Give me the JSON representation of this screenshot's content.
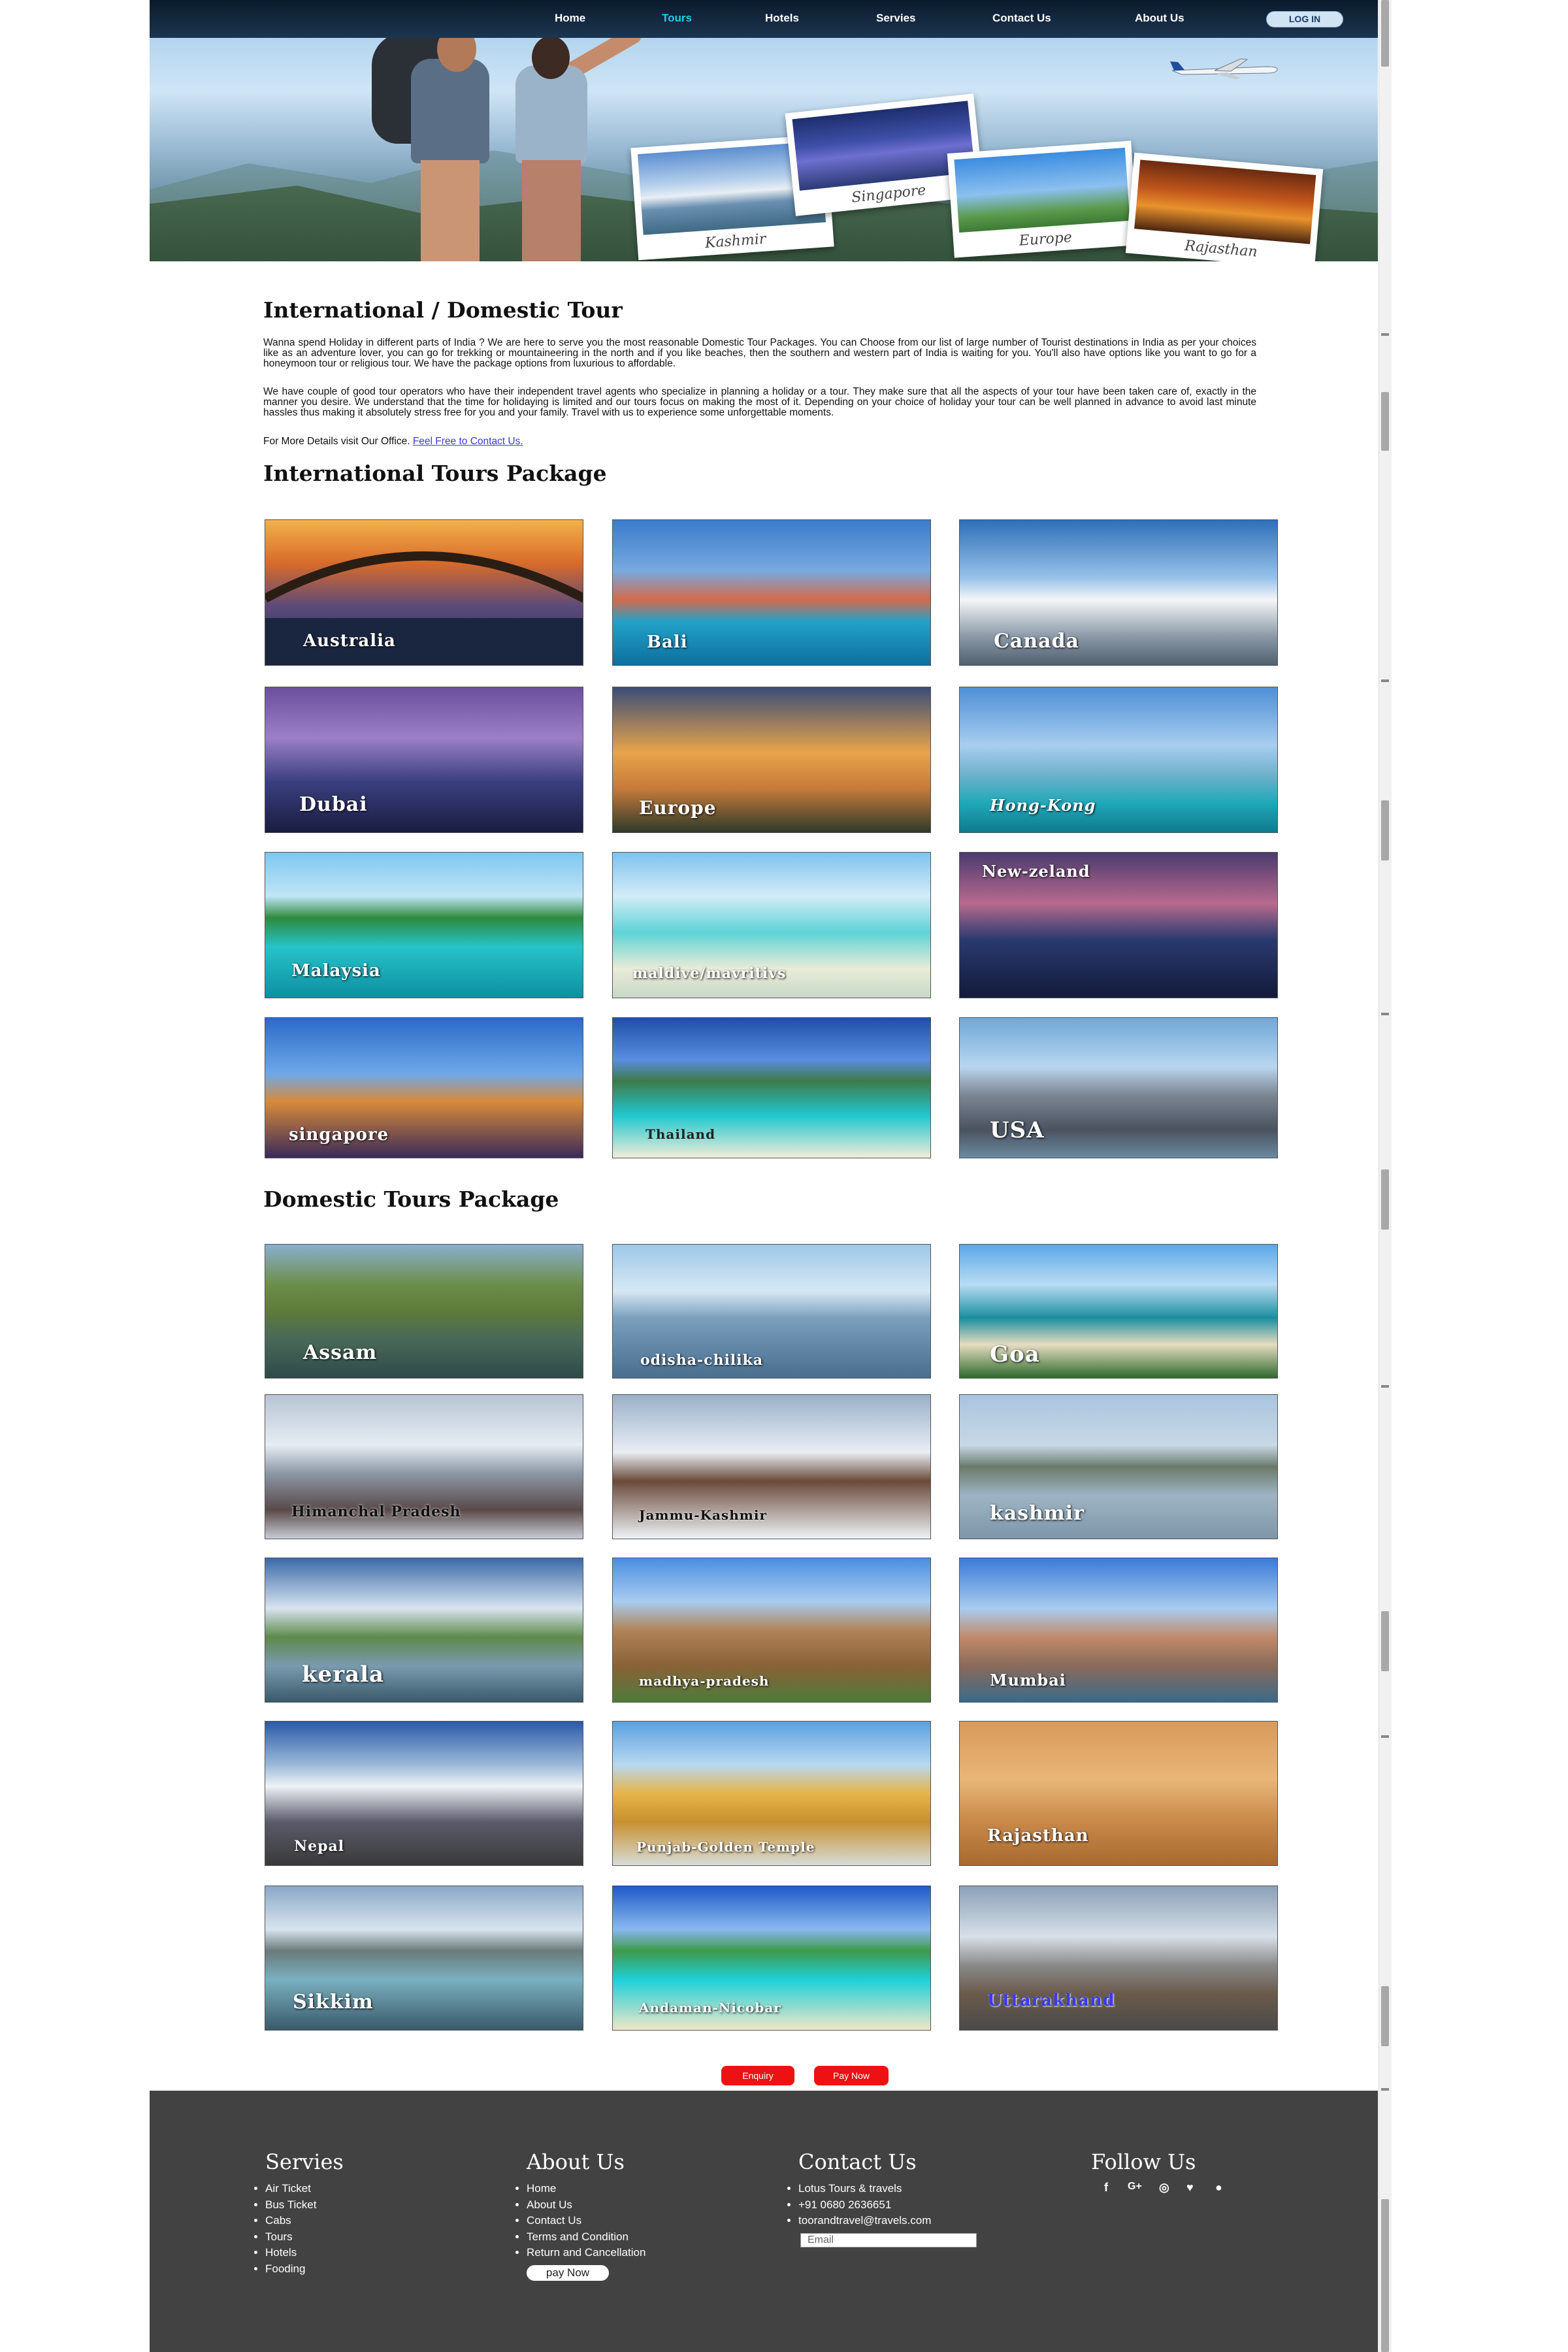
{
  "nav": {
    "items": [
      {
        "label": "Home"
      },
      {
        "label": "Tours"
      },
      {
        "label": "Hotels"
      },
      {
        "label": "Servies"
      },
      {
        "label": "Contact Us"
      },
      {
        "label": "About Us"
      }
    ],
    "active": "Tours",
    "login_label": "LOG IN"
  },
  "hero": {
    "photos": [
      {
        "caption": "Kashmir"
      },
      {
        "caption": "Singapore"
      },
      {
        "caption": "Europe"
      },
      {
        "caption": "Rajasthan"
      }
    ]
  },
  "intro": {
    "title": "International / Domestic Tour",
    "para1": "Wanna spend Holiday in different parts of India ? We are here to serve you the most reasonable Domestic Tour Packages. You can Choose from our list of large number of Tourist destinations in India as per your choices like as an adventure lover, you can go for trekking or mountaineering in the north and if you like beaches, then the southern and western part of India is waiting for you. You'll also have options like you want to go for a honeymoon tour or religious tour. We have the package options from luxurious to affordable.",
    "para2": "We have couple of good tour operators who have their independent travel agents who specialize in planning a holiday or a tour. They make sure that all the aspects of your tour have been taken care of, exactly in the manner you desire. We understand that the time for holidaying is limited and our tours focus on making the most of it. Depending on your choice of holiday your tour can be well planned in advance to avoid last minute hassles thus making it absolutely stress free for you and your family. Travel with us to experience some unforgettable moments.",
    "details_prefix": "For More Details visit Our Office.",
    "details_link": "Feel Free to Contact Us."
  },
  "international": {
    "title": "International Tours Package",
    "tiles": [
      {
        "label": "Australia"
      },
      {
        "label": "Bali"
      },
      {
        "label": "Canada"
      },
      {
        "label": "Dubai"
      },
      {
        "label": "Europe"
      },
      {
        "label": "Hong-Kong"
      },
      {
        "label": "Malaysia"
      },
      {
        "label": "maldive/mavritivs"
      },
      {
        "label": "New-zeland"
      },
      {
        "label": "singapore"
      },
      {
        "label": "Thailand"
      },
      {
        "label": "USA"
      }
    ]
  },
  "domestic": {
    "title": "Domestic Tours Package",
    "tiles": [
      {
        "label": "Assam"
      },
      {
        "label": "odisha-chilika"
      },
      {
        "label": "Goa"
      },
      {
        "label": "Himanchal Pradesh"
      },
      {
        "label": "Jammu-Kashmir"
      },
      {
        "label": "kashmir"
      },
      {
        "label": "kerala"
      },
      {
        "label": "madhya-pradesh"
      },
      {
        "label": "Mumbai"
      },
      {
        "label": "Nepal"
      },
      {
        "label": "Punjab-Golden Temple"
      },
      {
        "label": "Rajasthan"
      },
      {
        "label": "Sikkim"
      },
      {
        "label": "Andaman-Nicobar"
      },
      {
        "label": "Uttarakhand"
      }
    ]
  },
  "actions": {
    "enquiry": "Enquiry",
    "pay_now": "Pay Now"
  },
  "footer": {
    "services": {
      "title": "Servies",
      "items": [
        "Air Ticket",
        "Bus Ticket",
        "Cabs",
        "Tours",
        "Hotels",
        "Fooding"
      ]
    },
    "about": {
      "title": "About Us",
      "items": [
        "Home",
        "About Us",
        "Contact Us",
        "Terms and Condition",
        "Return and Cancellation"
      ],
      "pay_now": "pay Now"
    },
    "contact": {
      "title": "Contact Us",
      "items": [
        "Lotus Tours & travels",
        "+91 0680 2636651",
        "toorandtravel@travels.com"
      ],
      "email_placeholder": "Email"
    },
    "follow": {
      "title": "Follow Us",
      "icons": [
        "facebook-icon",
        "google-plus-icon",
        "instagram-icon",
        "twitter-icon",
        "pinterest-icon"
      ]
    }
  }
}
